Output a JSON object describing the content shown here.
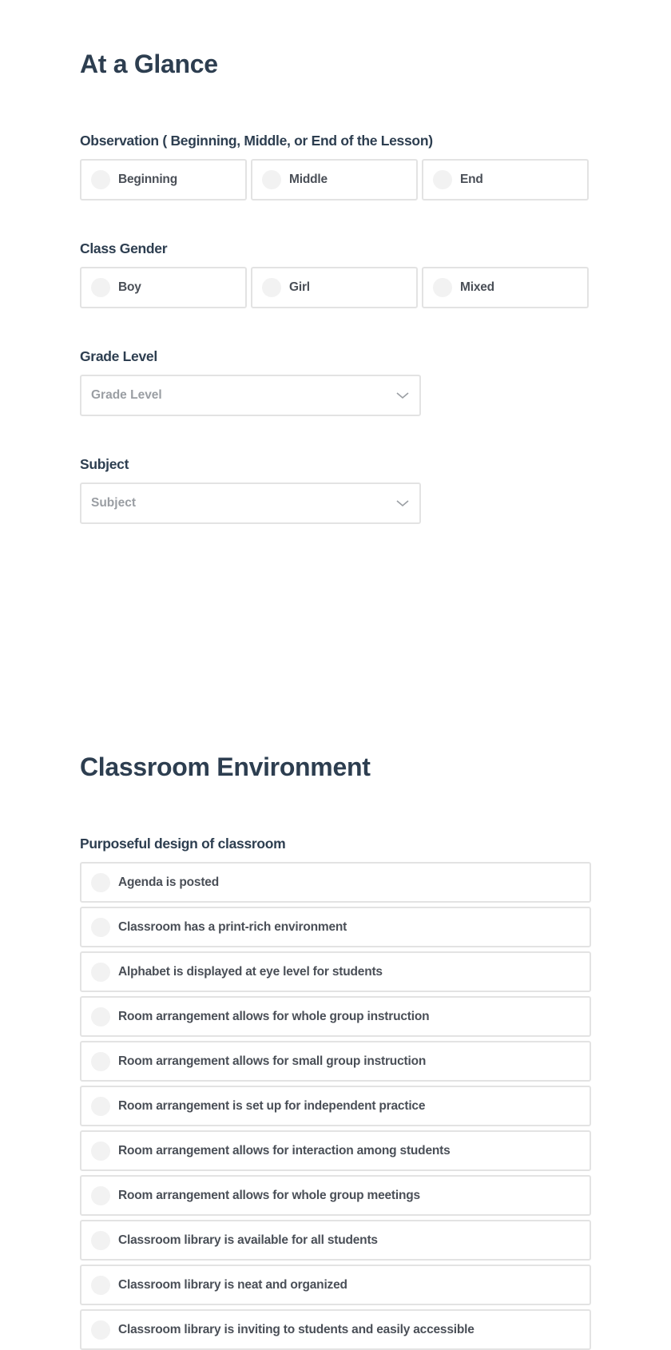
{
  "sections": {
    "at_a_glance": {
      "title": "At a Glance",
      "observation": {
        "label": "Observation ( Beginning, Middle, or End of the Lesson)",
        "options": [
          "Beginning",
          "Middle",
          "End"
        ]
      },
      "class_gender": {
        "label": "Class Gender",
        "options": [
          "Boy",
          "Girl",
          "Mixed"
        ]
      },
      "grade_level": {
        "label": "Grade Level",
        "placeholder": "Grade Level"
      },
      "subject": {
        "label": "Subject",
        "placeholder": "Subject"
      }
    },
    "classroom_environment": {
      "title": "Classroom Environment",
      "purposeful_design": {
        "label": "Purposeful design of classroom",
        "options": [
          "Agenda is posted",
          "Classroom has a print-rich environment",
          "Alphabet is displayed at eye level for students",
          "Room arrangement allows for whole group instruction",
          "Room arrangement allows for small group instruction",
          "Room arrangement is set up for independent practice",
          "Room arrangement allows for interaction among students",
          "Room arrangement allows for whole group meetings",
          "Classroom library is available for all students",
          "Classroom library is neat and organized",
          "Classroom library is inviting to students and easily accessible"
        ]
      }
    }
  }
}
